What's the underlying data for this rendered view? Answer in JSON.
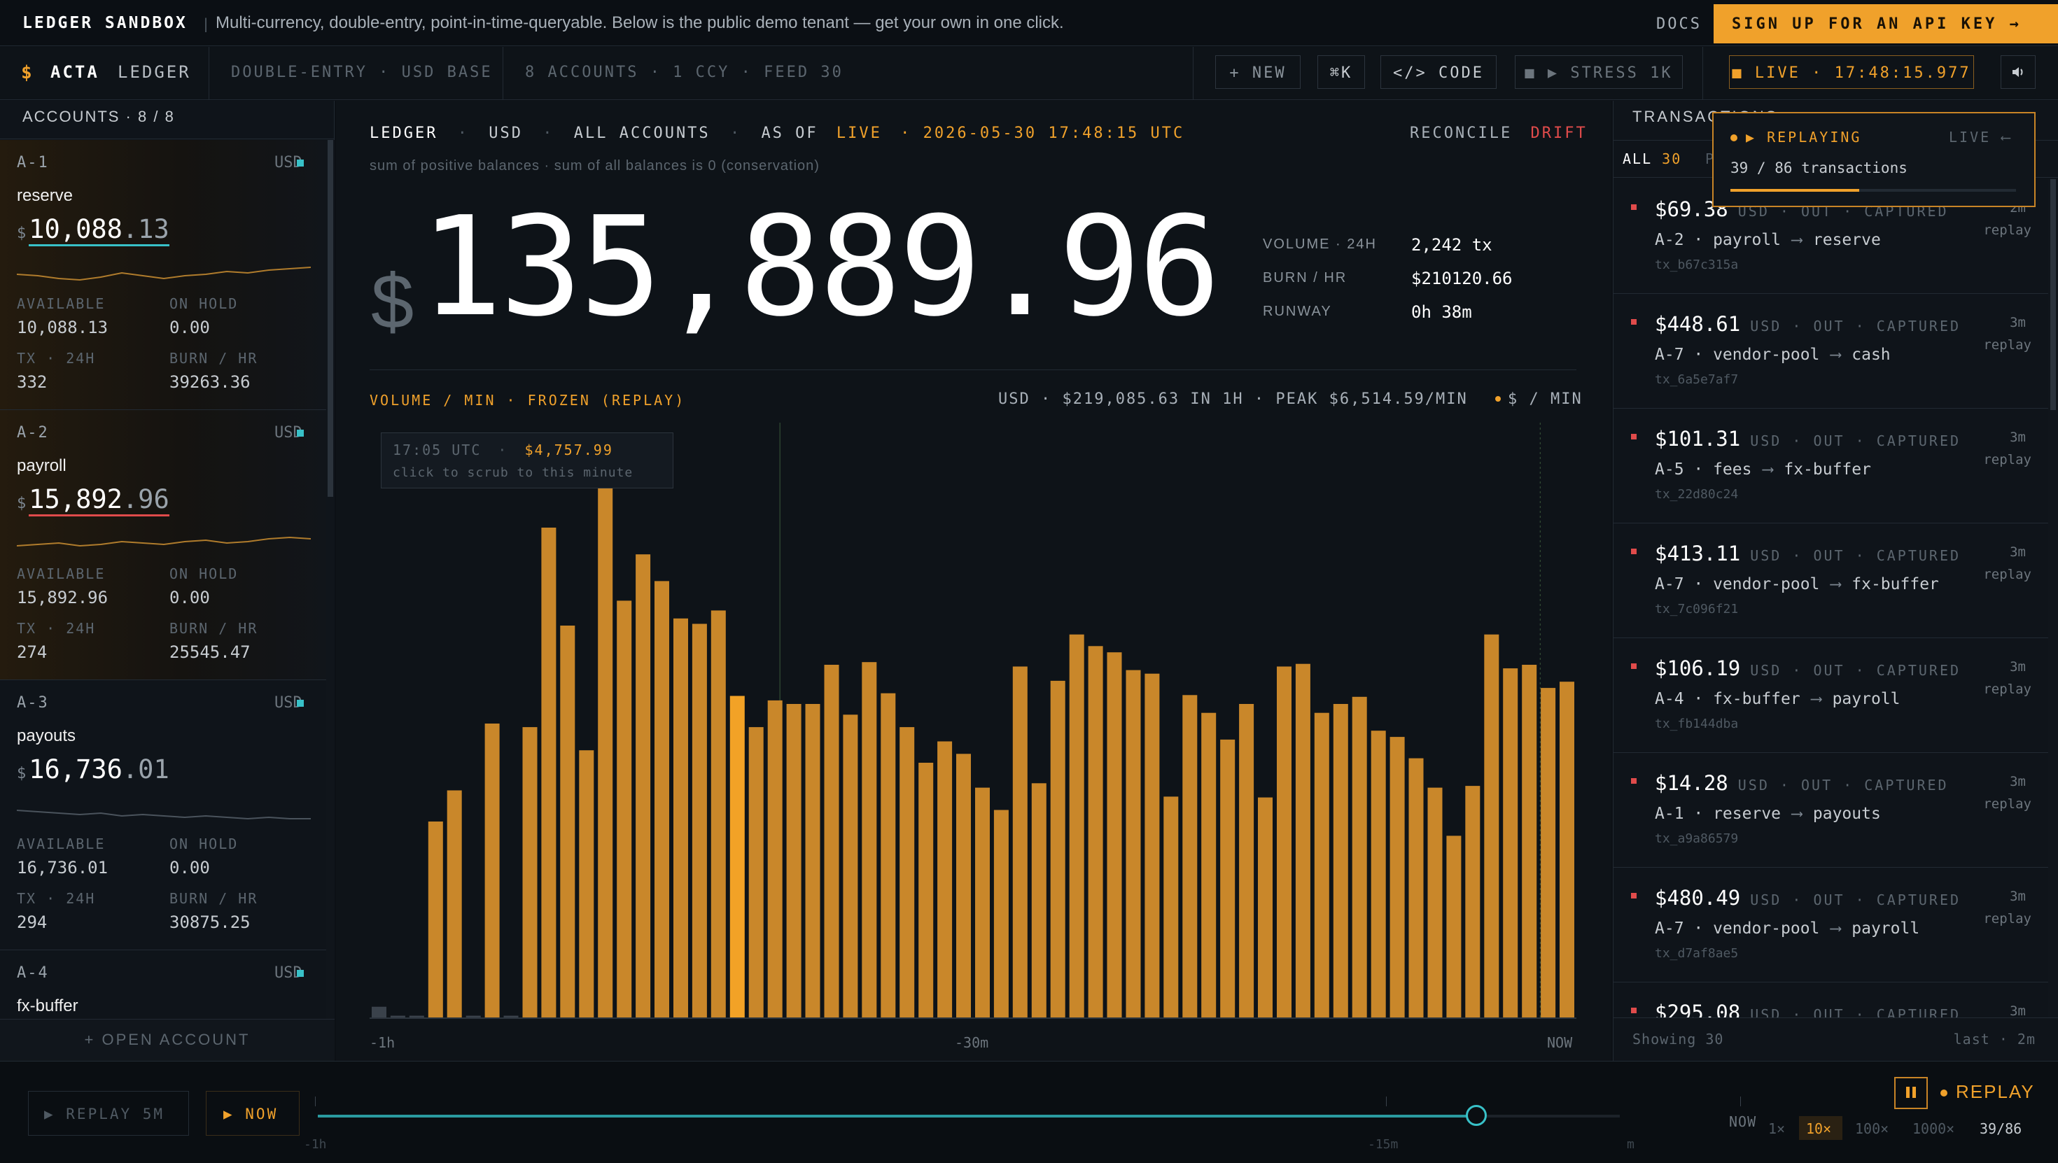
{
  "banner": {
    "brand": "LEDGER SANDBOX",
    "tagline": "Multi-currency, double-entry, point-in-time-queryable. Below is the public demo tenant — get your own in one click.",
    "docs": "DOCS",
    "signup": "SIGN UP FOR AN API KEY →"
  },
  "toolbar": {
    "logo_glyph": "$",
    "app_name": "ACTA",
    "app_sub": "LEDGER",
    "mode": "DOUBLE-ENTRY · USD BASE",
    "stats": "8 ACCOUNTS · 1 CCY · FEED 30",
    "new": "+ NEW",
    "kbd": "⌘K",
    "code": "</> CODE",
    "stress": "■ ▶ STRESS 1K",
    "live": "■ LIVE · 17:48:15.977",
    "sound_icon": "speaker-icon"
  },
  "accounts": {
    "header": "ACCOUNTS · 8 / 8",
    "open": "+ OPEN ACCOUNT",
    "labels": {
      "available": "AVAILABLE",
      "on_hold": "ON HOLD",
      "tx24": "TX · 24H",
      "burn": "BURN / HR"
    },
    "items": [
      {
        "id": "A-1",
        "ccy": "USD",
        "name": "reserve",
        "bal_int": "10,088",
        "bal_dec": ".13",
        "available": "10,088.13",
        "on_hold": "0.00",
        "tx24": "332",
        "burn": "39263.36",
        "underline": "#38c1c8"
      },
      {
        "id": "A-2",
        "ccy": "USD",
        "name": "payroll",
        "bal_int": "15,892",
        "bal_dec": ".96",
        "available": "15,892.96",
        "on_hold": "0.00",
        "tx24": "274",
        "burn": "25545.47",
        "underline": "#e04b4b"
      },
      {
        "id": "A-3",
        "ccy": "USD",
        "name": "payouts",
        "bal_int": "16,736",
        "bal_dec": ".01",
        "available": "16,736.01",
        "on_hold": "0.00",
        "tx24": "294",
        "burn": "30875.25",
        "underline": ""
      },
      {
        "id": "A-4",
        "ccy": "USD",
        "name": "fx-buffer"
      }
    ]
  },
  "ledger": {
    "crumb": [
      "LEDGER",
      "USD",
      "ALL ACCOUNTS",
      "AS OF"
    ],
    "live": "LIVE",
    "asof": "· 2026-05-30 17:48:15 UTC",
    "reconcile": "RECONCILE",
    "drift": "DRIFT",
    "sub": "sum of positive balances · sum of all balances is 0 (conservation)",
    "currency": "$",
    "total": "135,889.96",
    "metrics": [
      {
        "k": "VOLUME · 24H",
        "v": "2,242 tx"
      },
      {
        "k": "BURN / HR",
        "v": "$210120.66"
      },
      {
        "k": "RUNWAY",
        "v": "0h 38m"
      }
    ],
    "chart_title": "VOLUME / MIN · FROZEN (REPLAY)",
    "chart_summary": "USD · $219,085.63 IN 1H · PEAK $6,514.59/MIN",
    "legend": "$ / MIN",
    "tooltip_time": "17:05 UTC",
    "tooltip_value": "$4,757.99",
    "tooltip_hint": "click to scrub to this minute",
    "axis": [
      "-1h",
      "-30m",
      "NOW"
    ]
  },
  "chart_data": {
    "type": "bar",
    "ylim": [
      0,
      6600
    ],
    "x": [
      "-1h",
      "-30m",
      "NOW"
    ],
    "values": [
      120,
      20,
      20,
      2200,
      2550,
      20,
      3300,
      20,
      3260,
      5500,
      4400,
      3000,
      6100,
      4680,
      5200,
      4900,
      4480,
      4420,
      4570,
      3610,
      3260,
      3560,
      3520,
      3520,
      3960,
      3400,
      3990,
      3640,
      3260,
      2860,
      3100,
      2960,
      2580,
      2330,
      3940,
      2630,
      3780,
      4300,
      4170,
      4100,
      3900,
      3860,
      2480,
      3620,
      3420,
      3120,
      3520,
      2470,
      3940,
      3970,
      3420,
      3520,
      3600,
      3220,
      3150,
      2910,
      2580,
      2040,
      2600,
      4300,
      3920,
      3960,
      3700,
      3770
    ],
    "highlight_index": 19
  },
  "transactions": {
    "header": "TRANSACTIONS",
    "filters": [
      "ALL",
      "30",
      "P"
    ],
    "replaying": "▶ REPLAYING",
    "live_back": "LIVE ⟵",
    "replay_count": "39 / 86 transactions",
    "replay_progress": 0.45,
    "footer_left": "Showing 30",
    "footer_right": "last · 2m",
    "status": "USD · OUT · CAPTURED",
    "replay": "replay",
    "items": [
      {
        "amt": "$69.38",
        "from": "A-2 · payroll",
        "to": "reserve",
        "id": "tx_b67c315a",
        "ago": "2m"
      },
      {
        "amt": "$448.61",
        "from": "A-7 · vendor-pool",
        "to": "cash",
        "id": "tx_6a5e7af7",
        "ago": "3m"
      },
      {
        "amt": "$101.31",
        "from": "A-5 · fees",
        "to": "fx-buffer",
        "id": "tx_22d80c24",
        "ago": "3m"
      },
      {
        "amt": "$413.11",
        "from": "A-7 · vendor-pool",
        "to": "fx-buffer",
        "id": "tx_7c096f21",
        "ago": "3m"
      },
      {
        "amt": "$106.19",
        "from": "A-4 · fx-buffer",
        "to": "payroll",
        "id": "tx_fb144dba",
        "ago": "3m"
      },
      {
        "amt": "$14.28",
        "from": "A-1 · reserve",
        "to": "payouts",
        "id": "tx_a9a86579",
        "ago": "3m"
      },
      {
        "amt": "$480.49",
        "from": "A-7 · vendor-pool",
        "to": "payroll",
        "id": "tx_d7af8ae5",
        "ago": "3m"
      },
      {
        "amt": "$295.08",
        "from": "",
        "to": "",
        "id": "",
        "ago": "3m"
      }
    ]
  },
  "timeline": {
    "replay5": "▶ REPLAY 5M",
    "now": "▶ NOW",
    "ticks": [
      "-1h",
      "-15m",
      "m",
      "NOW"
    ],
    "position": 0.89,
    "pause_icon": "pause-icon",
    "replay": "REPLAY",
    "speeds": [
      "1×",
      "10×",
      "100×",
      "1000×"
    ],
    "active_speed": "10×",
    "count": "39/86"
  }
}
